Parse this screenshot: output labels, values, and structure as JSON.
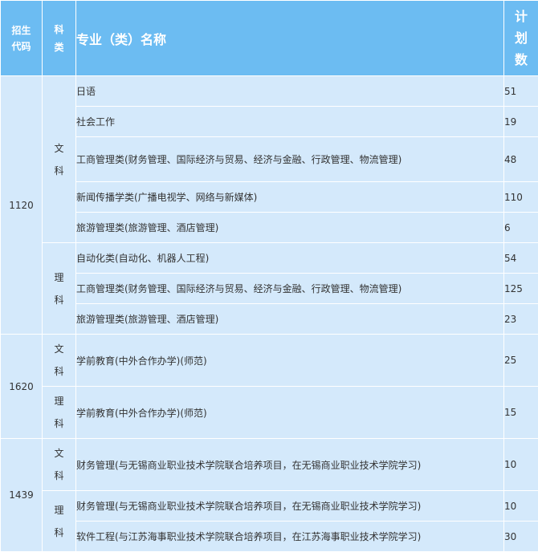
{
  "header": {
    "code": [
      "招生",
      "代码"
    ],
    "category": [
      "科",
      "类"
    ],
    "major": "专业（类）名称",
    "plan": [
      "计",
      "划",
      "数"
    ]
  },
  "categories": {
    "arts": [
      "文",
      "科"
    ],
    "science": [
      "理",
      "科"
    ]
  },
  "groups": [
    {
      "code": "1120",
      "sections": [
        {
          "category": "arts",
          "rows": [
            {
              "name": "日语",
              "count": "51"
            },
            {
              "name": "社会工作",
              "count": "19"
            },
            {
              "name": "工商管理类(财务管理、国际经济与贸易、经济与金融、行政管理、物流管理)",
              "count": "48"
            },
            {
              "name": "新闻传播学类(广播电视学、网络与新媒体)",
              "count": "110"
            },
            {
              "name": "旅游管理类(旅游管理、酒店管理)",
              "count": "6"
            }
          ]
        },
        {
          "category": "science",
          "rows": [
            {
              "name": "自动化类(自动化、机器人工程)",
              "count": "54"
            },
            {
              "name": "工商管理类(财务管理、国际经济与贸易、经济与金融、行政管理、物流管理)",
              "count": "125"
            },
            {
              "name": "旅游管理类(旅游管理、酒店管理)",
              "count": "23"
            }
          ]
        }
      ]
    },
    {
      "code": "1620",
      "sections": [
        {
          "category": "arts",
          "rows": [
            {
              "name": "学前教育(中外合作办学)(师范)",
              "count": "25"
            }
          ]
        },
        {
          "category": "science",
          "rows": [
            {
              "name": "学前教育(中外合作办学)(师范)",
              "count": "15"
            }
          ]
        }
      ]
    },
    {
      "code": "1439",
      "sections": [
        {
          "category": "arts",
          "rows": [
            {
              "name": "财务管理(与无锡商业职业技术学院联合培养项目，在无锡商业职业技术学院学习)",
              "count": "10"
            }
          ]
        },
        {
          "category": "science",
          "rows": [
            {
              "name": "财务管理(与无锡商业职业技术学院联合培养项目，在无锡商业职业技术学院学习)",
              "count": "10"
            },
            {
              "name": "软件工程(与江苏海事职业技术学院联合培养项目，在江苏海事职业技术学院学习)",
              "count": "30"
            }
          ]
        }
      ]
    }
  ]
}
